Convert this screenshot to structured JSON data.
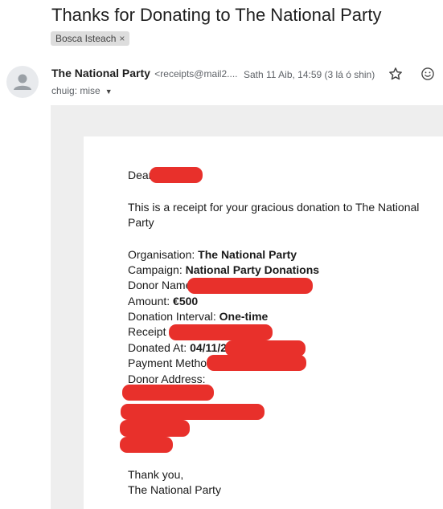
{
  "email": {
    "subject": "Thanks for Donating to The National Party",
    "label": "Bosca Isteach",
    "label_close": "×",
    "sender_name": "The National Party",
    "sender_email": "<receipts@mail2....",
    "date": "Sath 11 Aib, 14:59 (3 lá ó shin)",
    "to": "chuig: mise",
    "to_caret": "▼"
  },
  "message": {
    "greeting": "Dear",
    "intro_line1": "This is a receipt for your gracious donation to The National",
    "intro_line2": "Party",
    "organisation_label": "Organisation: ",
    "organisation_value": "The National Party",
    "campaign_label": "Campaign: ",
    "campaign_value": "National Party Donations",
    "donor_name_label": "Donor Name:",
    "amount_label": "Amount: ",
    "amount_value": "€500",
    "interval_label": "Donation Interval: ",
    "interval_value": "One-time",
    "receipt_label": "Receipt #",
    "donated_at_label": "Donated At: ",
    "donated_at_value": "04/11/26",
    "payment_method_label": "Payment Method",
    "donor_address_label": "Donor Address:",
    "sign_off1": "Thank you,",
    "sign_off2": "The National Party"
  },
  "colors": {
    "redaction": "#e8302b",
    "frame": "#eeeeee"
  }
}
